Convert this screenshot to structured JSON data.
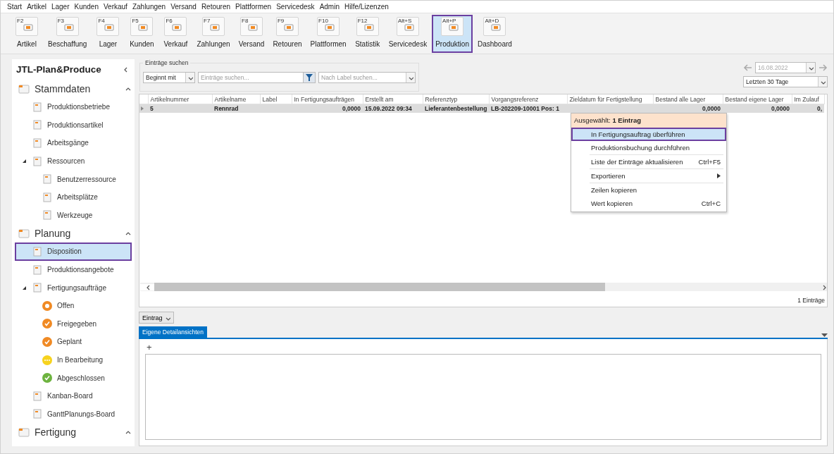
{
  "menu_bar": [
    "Start",
    "Artikel",
    "Lager",
    "Kunden",
    "Verkauf",
    "Zahlungen",
    "Versand",
    "Retouren",
    "Plattformen",
    "Servicedesk",
    "Admin",
    "Hilfe/Lizenzen"
  ],
  "toolbar": [
    {
      "key": "F2",
      "label": "Artikel",
      "selected": false
    },
    {
      "key": "F3",
      "label": "Beschaffung",
      "selected": false
    },
    {
      "key": "F4",
      "label": "Lager",
      "selected": false
    },
    {
      "key": "F5",
      "label": "Kunden",
      "selected": false
    },
    {
      "key": "F6",
      "label": "Verkauf",
      "selected": false
    },
    {
      "key": "F7",
      "label": "Zahlungen",
      "selected": false
    },
    {
      "key": "F8",
      "label": "Versand",
      "selected": false
    },
    {
      "key": "F9",
      "label": "Retouren",
      "selected": false
    },
    {
      "key": "F10",
      "label": "Plattformen",
      "selected": false
    },
    {
      "key": "F12",
      "label": "Statistik",
      "selected": false
    },
    {
      "key": "Alt+S",
      "label": "Servicedesk",
      "selected": false
    },
    {
      "key": "Alt+P",
      "label": "Produktion",
      "selected": true
    },
    {
      "key": "Alt+D",
      "label": "Dashboard",
      "selected": false
    }
  ],
  "sidebar": {
    "title": "JTL-Plan&Produce",
    "groups": [
      {
        "label": "Stammdaten",
        "expanded": true,
        "items": [
          {
            "label": "Produktionsbetriebe",
            "kind": "page",
            "selected": false
          },
          {
            "label": "Produktionsartikel",
            "kind": "page",
            "selected": false
          },
          {
            "label": "Arbeitsgänge",
            "kind": "page",
            "selected": false
          },
          {
            "label": "Ressourcen",
            "kind": "page",
            "selected": false,
            "expanded": true,
            "children": [
              {
                "label": "Benutzerressource",
                "kind": "page",
                "selected": false
              },
              {
                "label": "Arbeitsplätze",
                "kind": "page",
                "selected": false
              },
              {
                "label": "Werkzeuge",
                "kind": "page",
                "selected": false
              }
            ]
          }
        ]
      },
      {
        "label": "Planung",
        "expanded": true,
        "items": [
          {
            "label": "Disposition",
            "kind": "page",
            "selected": true
          },
          {
            "label": "Produktionsangebote",
            "kind": "page",
            "selected": false
          },
          {
            "label": "Fertigungsaufträge",
            "kind": "page",
            "selected": false,
            "expanded": true,
            "children": [
              {
                "label": "Offen",
                "kind": "ring",
                "color": "#f08a24",
                "selected": false
              },
              {
                "label": "Freigegeben",
                "kind": "tick",
                "color": "#f08a24",
                "selected": false
              },
              {
                "label": "Geplant",
                "kind": "tick",
                "color": "#f08a24",
                "selected": false
              },
              {
                "label": "In Bearbeitung",
                "kind": "dots",
                "color": "#f7d31e",
                "selected": false
              },
              {
                "label": "Abgeschlossen",
                "kind": "tick",
                "color": "#6db33f",
                "selected": false
              }
            ]
          },
          {
            "label": "Kanban-Board",
            "kind": "page",
            "selected": false
          },
          {
            "label": "GanttPlanungs-Board",
            "kind": "page",
            "selected": false
          }
        ]
      },
      {
        "label": "Fertigung",
        "expanded": true
      }
    ]
  },
  "search": {
    "title": "Einträge suchen",
    "mode": "Beginnt mit",
    "placeholder": "Einträge suchen...",
    "label_placeholder": "Nach Label suchen..."
  },
  "date_filter": {
    "date": "16.08.2022",
    "disabled": true,
    "range": "Letzten 30 Tage"
  },
  "table": {
    "columns": [
      "Artikelnummer",
      "Artikelname",
      "Label",
      "In Fertigungsaufträgen",
      "Erstellt am",
      "Referenztyp",
      "Vorgangsreferenz",
      "Zieldatum für Fertigstellung",
      "Bestand alle Lager",
      "Bestand eigene Lager",
      "Im Zulauf"
    ],
    "rows": [
      {
        "selected": true,
        "cells": [
          "5",
          "Rennrad",
          "",
          "0,0000",
          "15.09.2022 09:34",
          "Lieferantenbestellung",
          "LB-202209-10001 Pos: 1",
          "",
          "0,0000",
          "0,0000",
          "0,"
        ]
      }
    ],
    "footer": "1 Einträge"
  },
  "context_menu": {
    "header": "Ausgewählt:  **1 Eintrag**",
    "items": [
      {
        "label": "In Fertigungsauftrag überführen",
        "submenu": false,
        "selected": true,
        "separator_before": false
      },
      {
        "label": "Produktionsbuchung durchführen",
        "submenu": false,
        "selected": false,
        "separator_before": false
      },
      {
        "label": "Liste der Einträge aktualisieren",
        "shortcut": "Ctrl+F5",
        "submenu": false,
        "selected": false,
        "separator_before": true
      },
      {
        "label": "Exportieren",
        "submenu": true,
        "selected": false,
        "separator_before": true
      },
      {
        "label": "Zeilen kopieren",
        "submenu": false,
        "selected": false,
        "separator_before": true
      },
      {
        "label": "Wert kopieren",
        "shortcut": "Ctrl+C",
        "submenu": false,
        "selected": false,
        "separator_before": false
      }
    ]
  },
  "detail": {
    "button": "Eintrag",
    "tabs": [
      {
        "label": "Eigene Detailansichten",
        "selected": true
      }
    ],
    "add": "+"
  }
}
